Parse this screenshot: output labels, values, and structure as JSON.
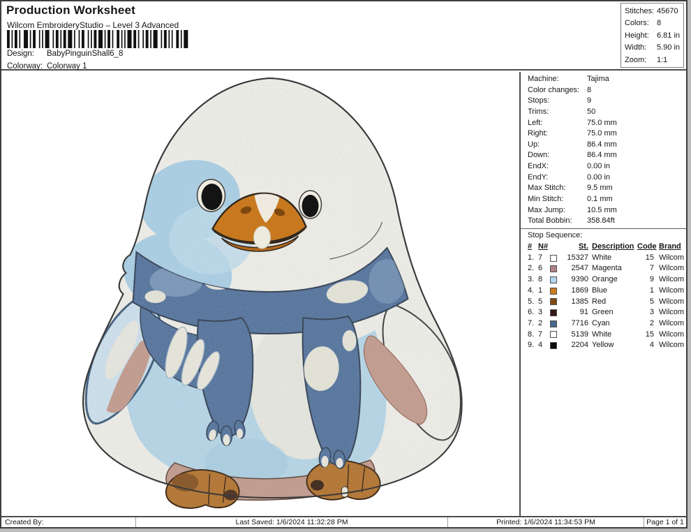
{
  "header": {
    "title": "Production Worksheet",
    "subtitle": "Wilcom EmbroideryStudio – Level 3 Advanced",
    "design_label": "Design:",
    "design_value": "BabyPinguinShall6_8",
    "colorway_label": "Colorway:",
    "colorway_value": "Colorway 1",
    "barcode_units": [
      2,
      1,
      1,
      1,
      2,
      1,
      1,
      2,
      3,
      1,
      1,
      1,
      2,
      2,
      1,
      1,
      1,
      1,
      3,
      2,
      1,
      1,
      2,
      1,
      1,
      1,
      2,
      1,
      3,
      1,
      1,
      2,
      1,
      1,
      2,
      2,
      1,
      1,
      1,
      1,
      2,
      1,
      3,
      1,
      1,
      1,
      2,
      1,
      1,
      2,
      2,
      1,
      1,
      1,
      1,
      1,
      3,
      1,
      2,
      1,
      1,
      2,
      1,
      1,
      2,
      1,
      1,
      1,
      3,
      2,
      1,
      1,
      2,
      1,
      1,
      1,
      1,
      2,
      2,
      1,
      1,
      1,
      3,
      1
    ]
  },
  "summary": {
    "rows": [
      {
        "label": "Stitches:",
        "value": "45670"
      },
      {
        "label": "Colors:",
        "value": "8"
      },
      {
        "label": "Height:",
        "value": "6.81 in"
      },
      {
        "label": "Width:",
        "value": "5.90 in"
      },
      {
        "label": "Zoom:",
        "value": "1:1"
      }
    ]
  },
  "machine_info": {
    "rows": [
      {
        "label": "Machine:",
        "value": "Tajima"
      },
      {
        "label": "Color changes:",
        "value": "8"
      },
      {
        "label": "Stops:",
        "value": "9"
      },
      {
        "label": "Trims:",
        "value": "50"
      },
      {
        "label": "Left:",
        "value": "75.0 mm"
      },
      {
        "label": "Right:",
        "value": "75.0 mm"
      },
      {
        "label": "Up:",
        "value": "86.4 mm"
      },
      {
        "label": "Down:",
        "value": "86.4 mm"
      },
      {
        "label": "EndX:",
        "value": "0.00 in"
      },
      {
        "label": "EndY:",
        "value": "0.00 in"
      },
      {
        "label": "Max Stitch:",
        "value": "9.5 mm"
      },
      {
        "label": "Min Stitch:",
        "value": "0.1 mm"
      },
      {
        "label": "Max Jump:",
        "value": "10.5 mm"
      },
      {
        "label": "Total Bobbin:",
        "value": "358.84ft"
      }
    ]
  },
  "stop_sequence": {
    "title": "Stop Sequence:",
    "columns": {
      "num": "#",
      "n": "N#",
      "st": "St.",
      "description": "Description",
      "code": "Code",
      "brand": "Brand"
    },
    "rows": [
      {
        "num": "1.",
        "n": "7",
        "swatch": "#ffffff",
        "st": "15327",
        "description": "White",
        "code": "15",
        "brand": "Wilcom"
      },
      {
        "num": "2.",
        "n": "6",
        "swatch": "#ae8183",
        "st": "2547",
        "description": "Magenta",
        "code": "7",
        "brand": "Wilcom"
      },
      {
        "num": "3.",
        "n": "8",
        "swatch": "#b5d5ec",
        "st": "9390",
        "description": "Orange",
        "code": "9",
        "brand": "Wilcom"
      },
      {
        "num": "4.",
        "n": "1",
        "swatch": "#cc7a1e",
        "st": "1869",
        "description": "Blue",
        "code": "1",
        "brand": "Wilcom"
      },
      {
        "num": "5.",
        "n": "5",
        "swatch": "#7e4a12",
        "st": "1385",
        "description": "Red",
        "code": "5",
        "brand": "Wilcom"
      },
      {
        "num": "6.",
        "n": "3",
        "swatch": "#35181a",
        "st": "91",
        "description": "Green",
        "code": "3",
        "brand": "Wilcom"
      },
      {
        "num": "7.",
        "n": "2",
        "swatch": "#46688e",
        "st": "7716",
        "description": "Cyan",
        "code": "2",
        "brand": "Wilcom"
      },
      {
        "num": "8.",
        "n": "7",
        "swatch": "#ffffff",
        "st": "5139",
        "description": "White",
        "code": "15",
        "brand": "Wilcom"
      },
      {
        "num": "9.",
        "n": "4",
        "swatch": "#0a0a0a",
        "st": "2204",
        "description": "Yellow",
        "code": "4",
        "brand": "Wilcom"
      }
    ]
  },
  "footer": {
    "created_by": "Created By:",
    "last_saved": "Last Saved: 1/6/2024 11:32:28 PM",
    "printed": "Printed: 1/6/2024 11:34:53 PM",
    "page": "Page 1 of 1"
  },
  "design_preview": {
    "alt": "Baby penguin wearing a scarf - embroidery stitch preview",
    "palette": {
      "body": "#f2f0e9",
      "patch_blue": "#abd0e6",
      "belly_blue": "#b7d7e8",
      "belly_pale": "#e9e9e1",
      "wing_blue": "#cfe2ee",
      "scarf": "#52719b",
      "scarf_light": "#7f9cbd",
      "scarf_snow": "#e8e6d8",
      "tan": "#c49a8b",
      "beak": "#c8791f",
      "beak_dark": "#b4691c",
      "feet": "#b5722a",
      "eye": "#141414",
      "outline": "#3a3a3a"
    }
  }
}
